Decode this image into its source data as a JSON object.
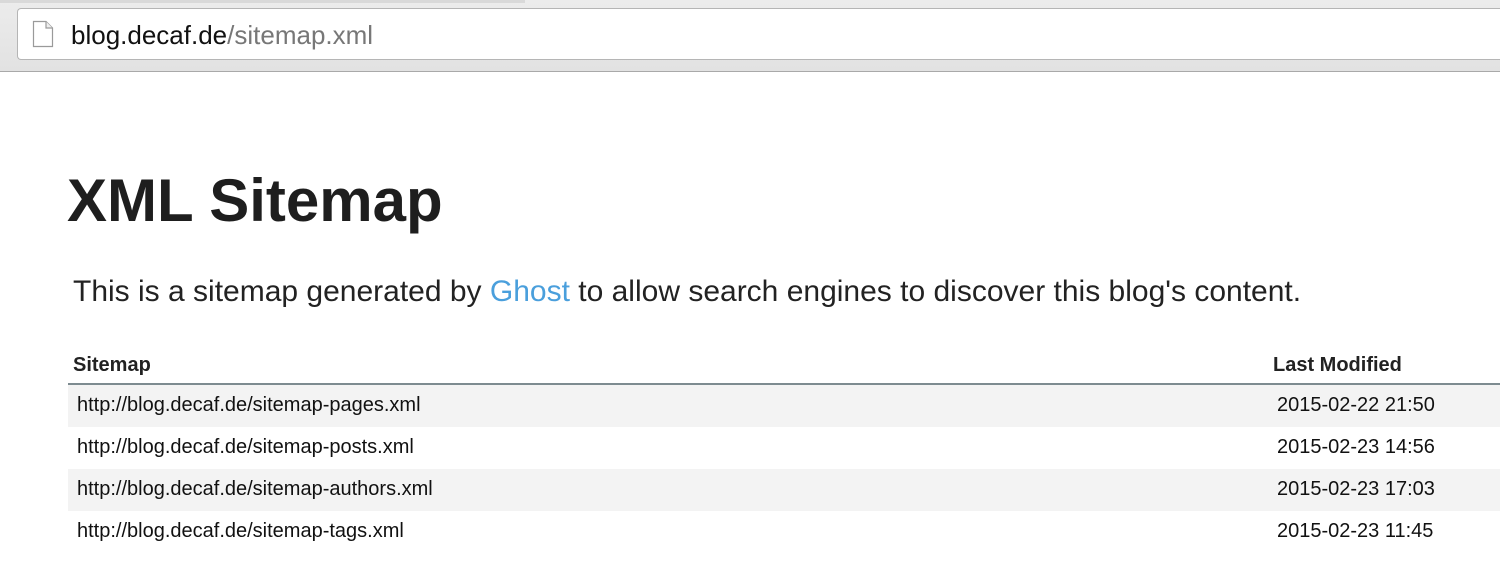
{
  "browser": {
    "url_host": "blog.decaf.de",
    "url_path": "/sitemap.xml",
    "page_icon": "document-icon"
  },
  "page": {
    "title": "XML Sitemap",
    "intro_before": "This is a sitemap generated by ",
    "intro_link": "Ghost",
    "intro_after": " to allow search engines to discover this blog's content.",
    "link_color": "#4a9fdc"
  },
  "table": {
    "headers": {
      "sitemap": "Sitemap",
      "last_modified": "Last Modified"
    },
    "rows": [
      {
        "url": "http://blog.decaf.de/sitemap-pages.xml",
        "modified": "2015-02-22 21:50"
      },
      {
        "url": "http://blog.decaf.de/sitemap-posts.xml",
        "modified": "2015-02-23 14:56"
      },
      {
        "url": "http://blog.decaf.de/sitemap-authors.xml",
        "modified": "2015-02-23 17:03"
      },
      {
        "url": "http://blog.decaf.de/sitemap-tags.xml",
        "modified": "2015-02-23 11:45"
      }
    ]
  }
}
